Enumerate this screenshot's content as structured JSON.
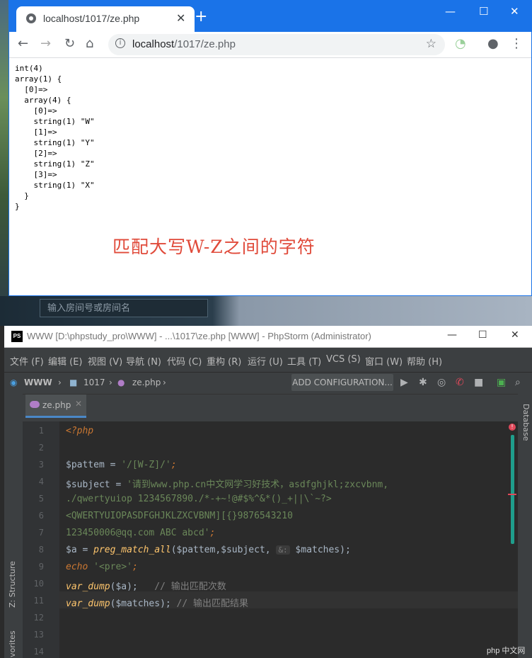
{
  "browser": {
    "tab_title": "localhost/1017/ze.php",
    "url_host": "localhost",
    "url_path": "/1017/ze.php",
    "output_lines": [
      "int(4)",
      "array(1) {",
      "  [0]=>",
      "  array(4) {",
      "    [0]=>",
      "    string(1) \"W\"",
      "    [1]=>",
      "    string(1) \"Y\"",
      "    [2]=>",
      "    string(1) \"Z\"",
      "    [3]=>",
      "    string(1) \"X\"",
      "  }",
      "}"
    ],
    "note": "匹配大写W-Z之间的字符"
  },
  "desktop": {
    "room_input_placeholder": "输入房间号或房间名"
  },
  "ide": {
    "title": "WWW [D:\\phpstudy_pro\\WWW] - ...\\1017\\ze.php [WWW] - PhpStorm (Administrator)",
    "logo": "PS",
    "menu": [
      "文件 (F)",
      "编辑 (E)",
      "视图 (V)",
      "导航 (N)",
      "代码 (C)",
      "重构 (R)",
      "运行 (U)",
      "工具 (T)",
      "VCS (S)",
      "窗口 (W)",
      "帮助 (H)"
    ],
    "breadcrumb": [
      "WWW",
      "1017",
      "ze.php"
    ],
    "add_configuration": "ADD CONFIGURATION...",
    "file_tab": "ze.php",
    "right_panel": "Database",
    "left_panel_structure": "Z: Structure",
    "left_panel_favorites": "vorites",
    "line_numbers": [
      "1",
      "2",
      "3",
      "4",
      "5",
      "6",
      "7",
      "8",
      "9",
      "10",
      "11",
      "12",
      "13",
      "14"
    ],
    "code": {
      "l1": "<?php",
      "l3_var": "$pattem",
      "l3_rest": " = ",
      "l3_str": "'/[W-Z]/'",
      "l3_end": ";",
      "l4_var": "$subject",
      "l4_eq": " = ",
      "l4_str": "'请到www.php.cn中文网学习好技术，asdfghjkl;zxcvbnm,",
      "l5_str": "./qwertyuiop 1234567890./*-+~!@#$%^&*()_+||\\`~?>",
      "l6_str": "<QWERTYUIOPASDFGHJKLZXCVBNM][{}9876543210",
      "l7_str": "123450006@qq.com ABC abcd'",
      "l7_end": ";",
      "l8_var": "$a",
      "l8_eq": " = ",
      "l8_fn": "preg_match_all",
      "l8_args1": "($pattem,$subject, ",
      "l8_hint": "&:",
      "l8_args2": " $matches);",
      "l9_kw": "echo",
      "l9_str": " '<pre>'",
      "l9_end": ";",
      "l10_fn": "var_dump",
      "l10_args": "($a);",
      "l10_cm": "   // 输出匹配次数",
      "l11_fn": "var_dump",
      "l11_args": "($matches);",
      "l11_cm": " // 输出匹配结果"
    }
  },
  "watermark": "php 中文网"
}
